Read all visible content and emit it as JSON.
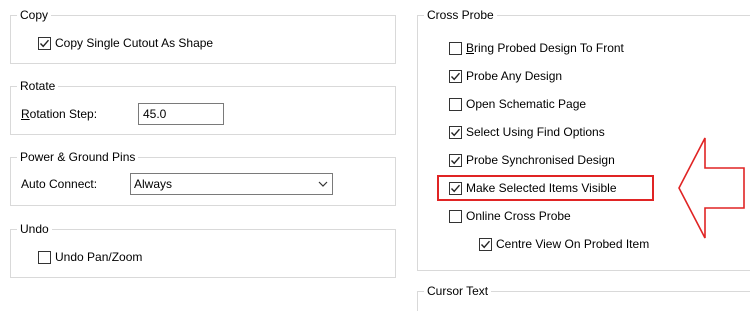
{
  "copy": {
    "title": "Copy",
    "copy_single_cutout": {
      "label": "Copy Single Cutout As Shape",
      "checked": true
    }
  },
  "rotate": {
    "title": "Rotate",
    "rotation_step_label": "Rotation Step:",
    "rotation_step_value": "45.0"
  },
  "power_ground": {
    "title": "Power & Ground Pins",
    "auto_connect_label": "Auto Connect:",
    "auto_connect_value": "Always"
  },
  "undo": {
    "title": "Undo",
    "undo_pan_zoom": {
      "label": "Undo Pan/Zoom",
      "checked": false
    }
  },
  "cross_probe": {
    "title": "Cross Probe",
    "options": [
      {
        "label": "Bring Probed Design To Front",
        "checked": false
      },
      {
        "label": "Probe Any Design",
        "checked": true
      },
      {
        "label": "Open Schematic Page",
        "checked": false
      },
      {
        "label": "Select Using Find Options",
        "checked": true
      },
      {
        "label": "Probe Synchronised Design",
        "checked": true
      },
      {
        "label": "Make Selected Items Visible",
        "checked": true
      },
      {
        "label": "Online Cross Probe",
        "checked": false
      },
      {
        "label": "Centre View On Probed Item",
        "checked": true
      }
    ]
  },
  "cursor_text": {
    "title": "Cursor Text"
  },
  "colors": {
    "highlight": "#e02424",
    "arrow": "#e02424"
  },
  "icons": {
    "check": "checkmark-icon",
    "dropdown": "chevron-down-icon",
    "annotation": "left-arrow-icon"
  }
}
